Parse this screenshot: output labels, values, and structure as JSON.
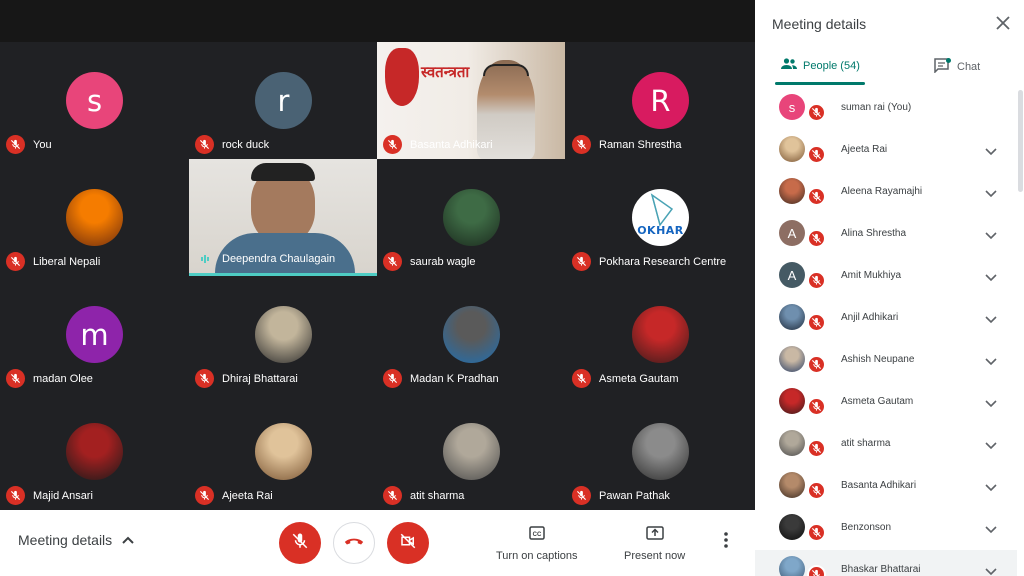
{
  "colors": {
    "accent": "#00796b",
    "mute_red": "#d93025",
    "stage": "#202124",
    "speaking": "#4ecdc4"
  },
  "grid": [
    {
      "name": "You",
      "avatar": {
        "type": "letter",
        "letter": "s",
        "color": "#e8457a"
      }
    },
    {
      "name": "rock duck",
      "avatar": {
        "type": "letter",
        "letter": "r",
        "color": "#4a6274"
      }
    },
    {
      "name": "Basanta Adhikari",
      "avatar": {
        "type": "video",
        "caption": "स्वतन्त्रता"
      }
    },
    {
      "name": "Raman Shrestha",
      "avatar": {
        "type": "letter",
        "letter": "R",
        "color": "#d81b60"
      }
    },
    {
      "name": "Liberal Nepali",
      "avatar": {
        "type": "photo",
        "colors": [
          "#f57c00",
          "#6d2c0e"
        ]
      }
    },
    {
      "name": "Deependra Chaulagain",
      "avatar": {
        "type": "video",
        "speaking": true
      }
    },
    {
      "name": "saurab wagle",
      "avatar": {
        "type": "photo",
        "colors": [
          "#3e6b45",
          "#1b2a1e"
        ]
      }
    },
    {
      "name": "Pokhara Research Centre",
      "avatar": {
        "type": "logo",
        "text": "OKHAR"
      }
    },
    {
      "name": "madan Olee",
      "avatar": {
        "type": "letter",
        "letter": "m",
        "color": "#8e24aa"
      }
    },
    {
      "name": "Dhiraj Bhattarai",
      "avatar": {
        "type": "photo",
        "colors": [
          "#c2b59b",
          "#2b2b2b"
        ]
      }
    },
    {
      "name": "Madan K Pradhan",
      "avatar": {
        "type": "photo",
        "colors": [
          "#5a5a5a",
          "#1f6fb2"
        ]
      }
    },
    {
      "name": "Asmeta Gautam",
      "avatar": {
        "type": "photo",
        "colors": [
          "#c62828",
          "#3a1b1b"
        ]
      }
    },
    {
      "name": "Majid Ansari",
      "avatar": {
        "type": "photo",
        "colors": [
          "#a32020",
          "#1a1a1a"
        ]
      }
    },
    {
      "name": "Ajeeta Rai",
      "avatar": {
        "type": "photo",
        "colors": [
          "#e0c39a",
          "#7a5533"
        ]
      }
    },
    {
      "name": "atit sharma",
      "avatar": {
        "type": "photo",
        "colors": [
          "#b0a89a",
          "#4a4a4a"
        ]
      }
    },
    {
      "name": "Pawan Pathak",
      "avatar": {
        "type": "photo",
        "colors": [
          "#8b8b8b",
          "#2d2d2d"
        ]
      }
    }
  ],
  "bottom_bar": {
    "meeting_details": "Meeting details",
    "captions": "Turn on captions",
    "present": "Present now",
    "icons": [
      "chevron-up-icon",
      "mic-off-icon",
      "hang-up-icon",
      "camera-off-icon",
      "cc-icon",
      "present-icon",
      "more-vert-icon"
    ]
  },
  "panel": {
    "title": "Meeting details",
    "tab_people": "People (54)",
    "tab_chat": "Chat",
    "people": [
      {
        "name": "suman rai (You)",
        "avatar": {
          "type": "letter",
          "letter": "s",
          "color": "#e8457a"
        },
        "expand": false
      },
      {
        "name": "Ajeeta Rai",
        "avatar": {
          "type": "photo",
          "colors": [
            "#e0c39a",
            "#7a5533"
          ]
        },
        "expand": true
      },
      {
        "name": "Aleena Rayamajhi",
        "avatar": {
          "type": "photo",
          "colors": [
            "#c76b4a",
            "#3d2a21"
          ]
        },
        "expand": true
      },
      {
        "name": "Alina Shrestha",
        "avatar": {
          "type": "letter",
          "letter": "A",
          "color": "#8d6e63"
        },
        "expand": true
      },
      {
        "name": "Amit Mukhiya",
        "avatar": {
          "type": "letter",
          "letter": "A",
          "color": "#455a64"
        },
        "expand": true
      },
      {
        "name": "Anjil Adhikari",
        "avatar": {
          "type": "photo",
          "colors": [
            "#6f8fae",
            "#1e2a3a"
          ]
        },
        "expand": true
      },
      {
        "name": "Ashish Neupane",
        "avatar": {
          "type": "photo",
          "colors": [
            "#c9b8a4",
            "#2a3f66"
          ]
        },
        "expand": true
      },
      {
        "name": "Asmeta Gautam",
        "avatar": {
          "type": "photo",
          "colors": [
            "#c62828",
            "#3a1b1b"
          ]
        },
        "expand": true
      },
      {
        "name": "atit sharma",
        "avatar": {
          "type": "photo",
          "colors": [
            "#b0a89a",
            "#4a4a4a"
          ]
        },
        "expand": true
      },
      {
        "name": "Basanta Adhikari",
        "avatar": {
          "type": "photo",
          "colors": [
            "#b48a6a",
            "#3a2a20"
          ]
        },
        "expand": true
      },
      {
        "name": "Benzonson",
        "avatar": {
          "type": "photo",
          "colors": [
            "#3a3a3a",
            "#0d0d0d"
          ]
        },
        "expand": true
      },
      {
        "name": "Bhaskar Bhattarai",
        "avatar": {
          "type": "photo",
          "colors": [
            "#7fa7c9",
            "#3b5570"
          ]
        },
        "expand": true
      }
    ]
  }
}
